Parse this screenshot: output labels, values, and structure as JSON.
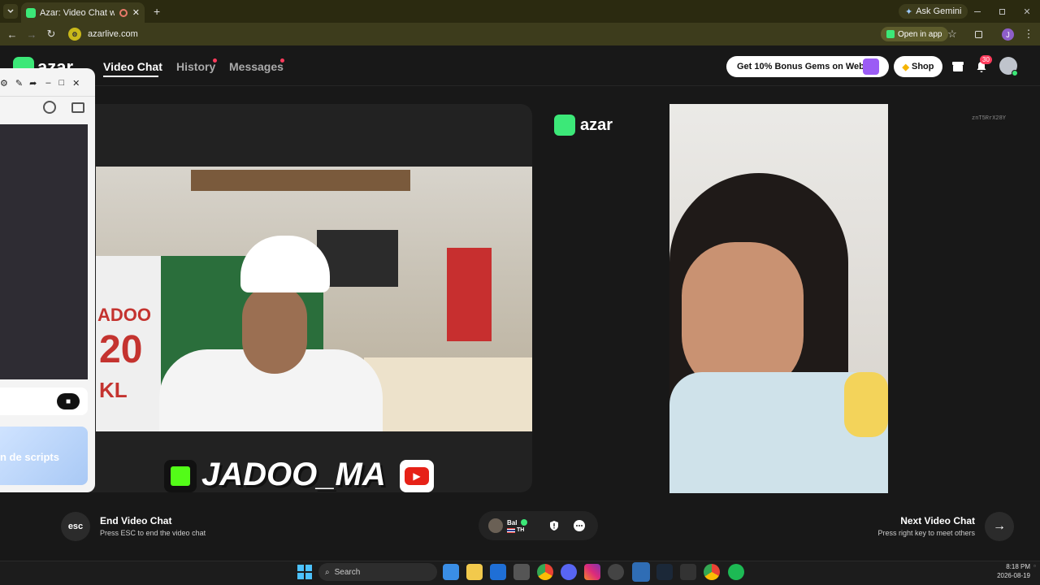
{
  "browser": {
    "tab_title": "Azar: Video Chat with New",
    "new_tab_label": "+",
    "ask_gemini": "Ask Gemini",
    "url": "azarlive.com",
    "open_in_app": "Open in app",
    "profile_initial": "J"
  },
  "nav": {
    "logo_text": "azar",
    "links": [
      {
        "label": "Video Chat"
      },
      {
        "label": "History"
      },
      {
        "label": "Messages"
      }
    ],
    "bonus_label": "Get 10% Bonus Gems on Web!",
    "shop_label": "Shop",
    "notification_count": "30"
  },
  "stream": {
    "watermark_logo": "azar",
    "session_code": "znT5RrX28Y",
    "streamer_name": "JADOO_MA",
    "jersey_text": "ADOO",
    "jersey_number": "20",
    "jersey_letters": "KL",
    "partial_text": "n de scripts"
  },
  "bottom": {
    "esc_key": "esc",
    "end_title": "End Video Chat",
    "end_sub": "Press ESC to end the video chat",
    "peer_name": "Bal",
    "peer_country": "TH",
    "next_title": "Next Video Chat",
    "next_sub": "Press right key to meet others"
  },
  "taskbar": {
    "search_placeholder": "Search",
    "time": "8:18 PM",
    "date": "2026-08-19"
  },
  "colors": {
    "azar_green": "#3ce878",
    "chrome_bar": "#2b2a10",
    "page_bg": "#181818",
    "alert_red": "#ff3b5c"
  }
}
